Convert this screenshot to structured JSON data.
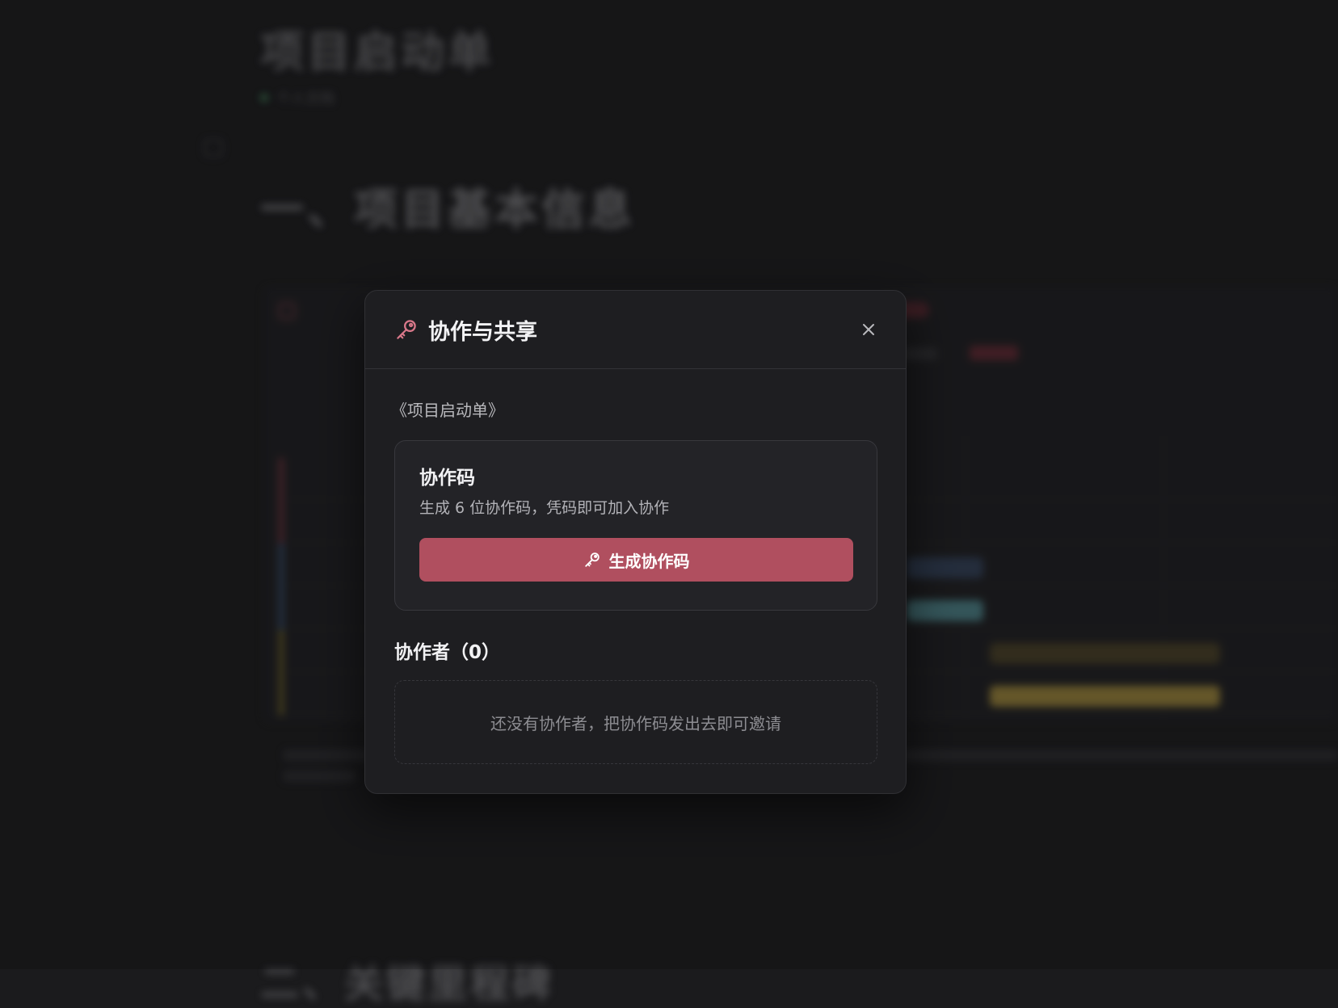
{
  "background": {
    "doc_title": "项目启动单",
    "status_text": "个人文档",
    "section_heading": "一、项目基本信息",
    "next_heading": "二、关键里程碑"
  },
  "modal": {
    "title": "协作与共享",
    "icon": "key-icon",
    "close_icon": "close-icon",
    "document_name": "《项目启动单》",
    "code_card": {
      "title": "协作码",
      "description": "生成 6 位协作码，凭码即可加入协作",
      "button_label": "生成协作码",
      "button_icon": "key-icon"
    },
    "collaborators": {
      "title": "协作者（0）",
      "count": 0,
      "empty_text": "还没有协作者，把协作码发出去即可邀请"
    }
  },
  "colors": {
    "accent": "#b04f5f",
    "icon_accent": "#d9788a",
    "modal_bg": "#1e1e21",
    "page_bg": "#1b1b1d"
  }
}
